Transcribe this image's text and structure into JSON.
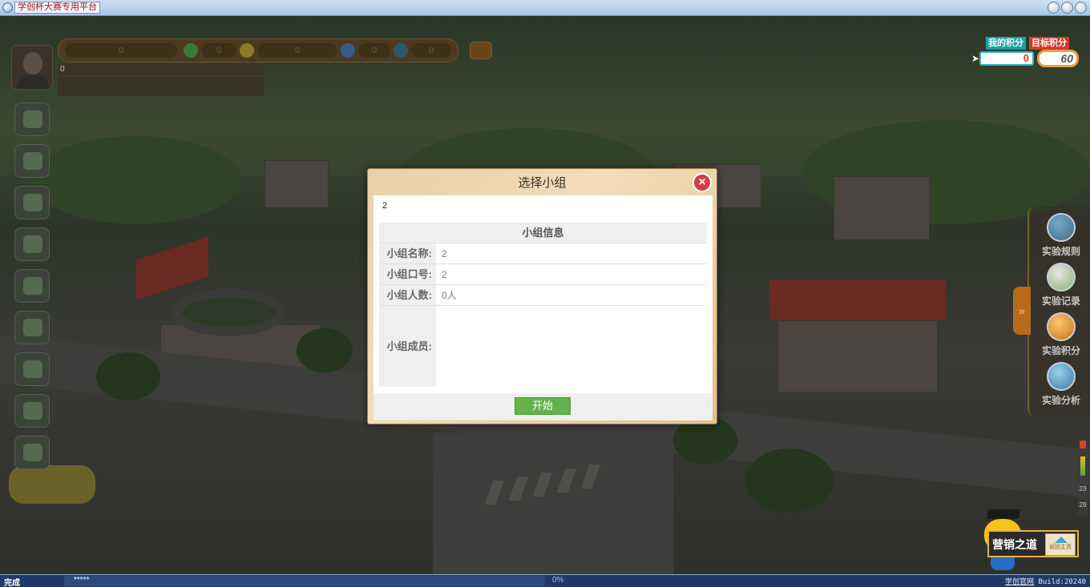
{
  "window": {
    "title": "学创杯大赛专用平台"
  },
  "hud": {
    "name_line": "0",
    "coins": "0",
    "stat2": "0",
    "stat3": "0",
    "stat4": "0",
    "stat5": "0"
  },
  "score": {
    "my_label": "我的积分",
    "target_label": "目标积分",
    "my_value": "0",
    "target_value": "60"
  },
  "right_menu": [
    {
      "label": "实验规则",
      "icon": "rules-icon"
    },
    {
      "label": "实验记录",
      "icon": "record-icon"
    },
    {
      "label": "实验积分",
      "icon": "score-icon"
    },
    {
      "label": "实验分析",
      "icon": "analysis-icon"
    }
  ],
  "meter": {
    "n1": "23",
    "n2": "29"
  },
  "brand": {
    "title": "营销之道",
    "home": "返回主页"
  },
  "modal": {
    "title": "选择小组",
    "close": "×",
    "selected_group": "2",
    "info_header": "小组信息",
    "rows": [
      {
        "label": "小组名称:",
        "value": "2"
      },
      {
        "label": "小组口号:",
        "value": "2"
      },
      {
        "label": "小组人数:",
        "value": "0人"
      },
      {
        "label": "小组成员:",
        "value": ""
      }
    ],
    "start": "开始"
  },
  "statusbar": {
    "status": "完成",
    "stars": "*****",
    "progress": "0%",
    "link": "学创官网",
    "build": "Build:20240"
  }
}
